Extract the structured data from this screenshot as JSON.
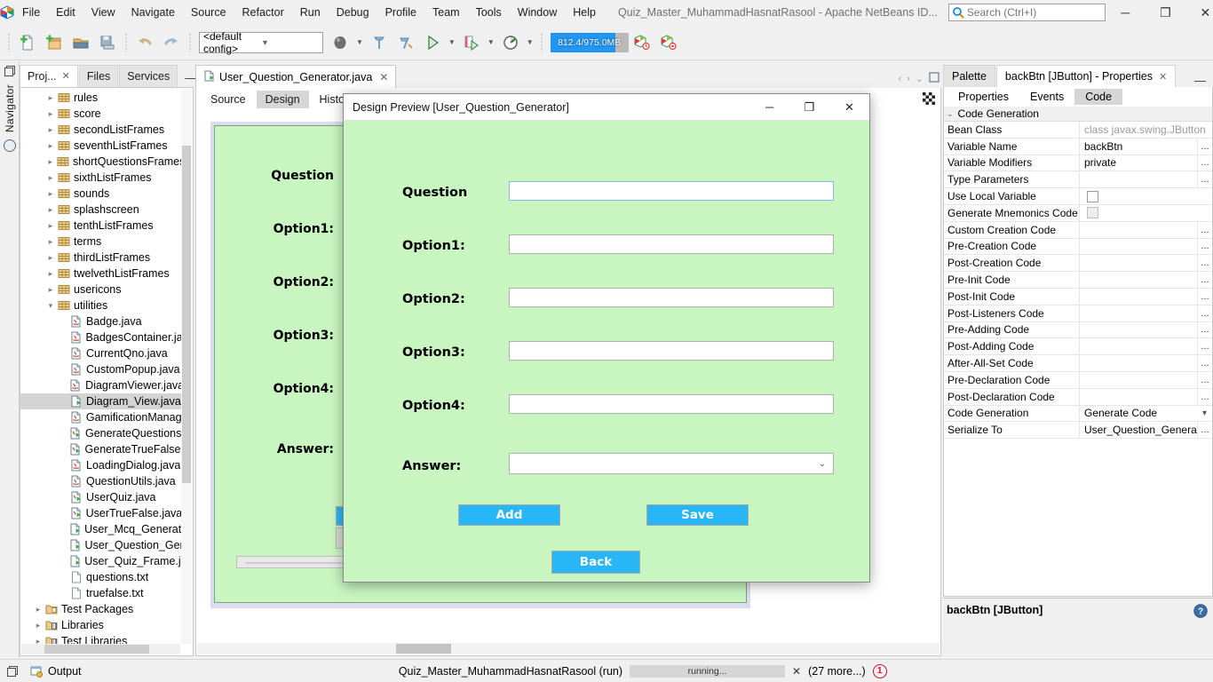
{
  "window": {
    "title": "Quiz_Master_MuhammadHasnatRasool - Apache NetBeans ID...",
    "minimize": "─",
    "maximize": "❐",
    "close": "✕"
  },
  "menubar": {
    "items": [
      "File",
      "Edit",
      "View",
      "Navigate",
      "Source",
      "Refactor",
      "Run",
      "Debug",
      "Profile",
      "Team",
      "Tools",
      "Window",
      "Help"
    ]
  },
  "search": {
    "placeholder": "Search (Ctrl+I)",
    "value": ""
  },
  "toolbar": {
    "config_value": "<default config>",
    "heap_text": "812.4/975.0MB",
    "heap_percent": 83
  },
  "navigator": {
    "label": "Navigator"
  },
  "projects": {
    "tabs": [
      {
        "label": "Proj...",
        "closable": true,
        "active": true
      },
      {
        "label": "Files",
        "closable": false,
        "active": false
      },
      {
        "label": "Services",
        "closable": false,
        "active": false
      }
    ],
    "minimize": "—",
    "tree": [
      {
        "label": "rules",
        "type": "package",
        "depth": 2,
        "expanded": false,
        "selected": false
      },
      {
        "label": "score",
        "type": "package",
        "depth": 2,
        "expanded": false,
        "selected": false
      },
      {
        "label": "secondListFrames",
        "type": "package",
        "depth": 2,
        "expanded": false,
        "selected": false
      },
      {
        "label": "seventhListFrames",
        "type": "package",
        "depth": 2,
        "expanded": false,
        "selected": false
      },
      {
        "label": "shortQuestionsFrames",
        "type": "package",
        "depth": 2,
        "expanded": false,
        "selected": false
      },
      {
        "label": "sixthListFrames",
        "type": "package",
        "depth": 2,
        "expanded": false,
        "selected": false
      },
      {
        "label": "sounds",
        "type": "package",
        "depth": 2,
        "expanded": false,
        "selected": false
      },
      {
        "label": "splashscreen",
        "type": "package",
        "depth": 2,
        "expanded": false,
        "selected": false
      },
      {
        "label": "tenthListFrames",
        "type": "package",
        "depth": 2,
        "expanded": false,
        "selected": false
      },
      {
        "label": "terms",
        "type": "package",
        "depth": 2,
        "expanded": false,
        "selected": false
      },
      {
        "label": "thirdListFrames",
        "type": "package",
        "depth": 2,
        "expanded": false,
        "selected": false
      },
      {
        "label": "twelvethListFrames",
        "type": "package",
        "depth": 2,
        "expanded": false,
        "selected": false
      },
      {
        "label": "usericons",
        "type": "package",
        "depth": 2,
        "expanded": false,
        "selected": false
      },
      {
        "label": "utilities",
        "type": "package",
        "depth": 2,
        "expanded": true,
        "selected": false
      },
      {
        "label": "Badge.java",
        "type": "java",
        "depth": 3,
        "selected": false
      },
      {
        "label": "BadgesContainer.ja",
        "type": "java",
        "depth": 3,
        "selected": false
      },
      {
        "label": "CurrentQno.java",
        "type": "java",
        "depth": 3,
        "selected": false
      },
      {
        "label": "CustomPopup.java",
        "type": "java",
        "depth": 3,
        "selected": false
      },
      {
        "label": "DiagramViewer.java",
        "type": "java",
        "depth": 3,
        "selected": false
      },
      {
        "label": "Diagram_View.java",
        "type": "form",
        "depth": 3,
        "selected": true
      },
      {
        "label": "GamificationManag",
        "type": "java",
        "depth": 3,
        "selected": false
      },
      {
        "label": "GenerateQuestions.",
        "type": "javamain",
        "depth": 3,
        "selected": false
      },
      {
        "label": "GenerateTrueFalse.j",
        "type": "javamain",
        "depth": 3,
        "selected": false
      },
      {
        "label": "LoadingDialog.java",
        "type": "java",
        "depth": 3,
        "selected": false
      },
      {
        "label": "QuestionUtils.java",
        "type": "java",
        "depth": 3,
        "selected": false
      },
      {
        "label": "UserQuiz.java",
        "type": "javamain",
        "depth": 3,
        "selected": false
      },
      {
        "label": "UserTrueFalse.java",
        "type": "javamain",
        "depth": 3,
        "selected": false
      },
      {
        "label": "User_Mcq_Generato",
        "type": "form",
        "depth": 3,
        "selected": false
      },
      {
        "label": "User_Question_Gen",
        "type": "form",
        "depth": 3,
        "selected": false
      },
      {
        "label": "User_Quiz_Frame.ja",
        "type": "form",
        "depth": 3,
        "selected": false
      },
      {
        "label": "questions.txt",
        "type": "txt",
        "depth": 3,
        "selected": false
      },
      {
        "label": "truefalse.txt",
        "type": "txt",
        "depth": 3,
        "selected": false
      },
      {
        "label": "Test Packages",
        "type": "folder",
        "depth": 1,
        "expanded": false,
        "selected": false
      },
      {
        "label": "Libraries",
        "type": "lib",
        "depth": 1,
        "expanded": false,
        "selected": false
      },
      {
        "label": "Test Libraries",
        "type": "lib",
        "depth": 1,
        "expanded": false,
        "selected": false
      }
    ]
  },
  "editor": {
    "tab_label": "User_Question_Generator.java",
    "tab_close": "✕",
    "view_tabs": [
      {
        "label": "Source",
        "active": false
      },
      {
        "label": "Design",
        "active": true
      },
      {
        "label": "History",
        "active": false
      }
    ],
    "nav_prev": "‹",
    "nav_next": "›",
    "nav_down": "⌄",
    "nav_max": "□",
    "canvas_form": {
      "labels": [
        "Question",
        "Option1:",
        "Option2:",
        "Option3:",
        "Option4:",
        "Answer:"
      ],
      "buttons": [
        "Add",
        "Save",
        "Back"
      ],
      "bg_color": "#c8f5c0",
      "button_color": "#29b6f6"
    }
  },
  "dialog": {
    "title": "Design Preview [User_Question_Generator]",
    "minimize": "─",
    "maximize": "❐",
    "close": "✕",
    "bg_color": "#c8f5c0",
    "fields": [
      {
        "label": "Question",
        "value": "",
        "focused": true
      },
      {
        "label": "Option1:",
        "value": "",
        "focused": false
      },
      {
        "label": "Option2:",
        "value": "",
        "focused": false
      },
      {
        "label": "Option3:",
        "value": "",
        "focused": false
      },
      {
        "label": "Option4:",
        "value": "",
        "focused": false
      }
    ],
    "answer": {
      "label": "Answer:",
      "value": "",
      "caret": "⌄"
    },
    "buttons": [
      {
        "label": "Add",
        "color": "#29b6f6"
      },
      {
        "label": "Save",
        "color": "#29b6f6"
      },
      {
        "label": "Back",
        "color": "#29b6f6"
      }
    ]
  },
  "properties": {
    "tabs": [
      {
        "label": "Palette",
        "closable": false,
        "active": false
      },
      {
        "label": "backBtn [JButton] - Properties",
        "closable": true,
        "active": true
      }
    ],
    "minimize": "—",
    "subtabs": [
      {
        "label": "Properties",
        "active": false
      },
      {
        "label": "Events",
        "active": false
      },
      {
        "label": "Code",
        "active": true
      }
    ],
    "group": {
      "label": "Code Generation",
      "caret": "⌄"
    },
    "rows": [
      {
        "key": "Bean Class",
        "value": "class javax.swing.JButton",
        "kind": "readonly"
      },
      {
        "key": "Variable Name",
        "value": "backBtn",
        "kind": "text"
      },
      {
        "key": "Variable Modifiers",
        "value": "private",
        "kind": "text"
      },
      {
        "key": "Type Parameters",
        "value": "",
        "kind": "text"
      },
      {
        "key": "Use Local Variable",
        "value": "",
        "kind": "checkbox"
      },
      {
        "key": "Generate Mnemonics Code",
        "value": "",
        "kind": "checkbox-dim"
      },
      {
        "key": "Custom Creation Code",
        "value": "",
        "kind": "text"
      },
      {
        "key": "Pre-Creation Code",
        "value": "",
        "kind": "text"
      },
      {
        "key": "Post-Creation Code",
        "value": "",
        "kind": "text"
      },
      {
        "key": "Pre-Init Code",
        "value": "",
        "kind": "text"
      },
      {
        "key": "Post-Init Code",
        "value": "",
        "kind": "text"
      },
      {
        "key": "Post-Listeners Code",
        "value": "",
        "kind": "text"
      },
      {
        "key": "Pre-Adding Code",
        "value": "",
        "kind": "text"
      },
      {
        "key": "Post-Adding Code",
        "value": "",
        "kind": "text"
      },
      {
        "key": "After-All-Set Code",
        "value": "",
        "kind": "text"
      },
      {
        "key": "Pre-Declaration Code",
        "value": "",
        "kind": "text"
      },
      {
        "key": "Post-Declaration Code",
        "value": "",
        "kind": "text"
      },
      {
        "key": "Code Generation",
        "value": "Generate Code",
        "kind": "combo"
      },
      {
        "key": "Serialize To",
        "value": "User_Question_Genera...",
        "kind": "text"
      }
    ],
    "footer_label": "backBtn [JButton]",
    "help_glyph": "?"
  },
  "statusbar": {
    "output_label": "Output",
    "task_label": "Quiz_Master_MuhammadHasnatRasool (run)",
    "progress_text": "running...",
    "cancel": "✕",
    "more_label": "(27 more...)",
    "error_count": "1"
  }
}
